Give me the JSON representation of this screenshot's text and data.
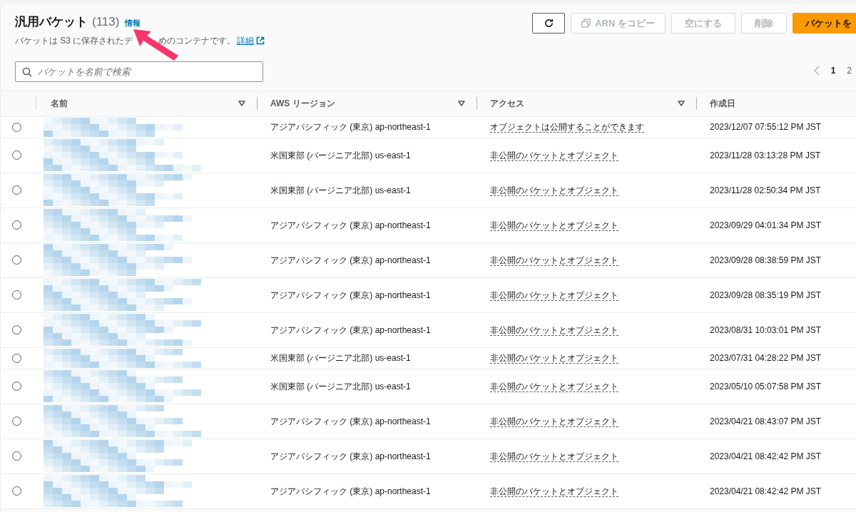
{
  "header": {
    "title": "汎用バケット",
    "count": "(113)",
    "info_link": "情報",
    "description_before": "バケットは S3 に保存されたデ",
    "description_after": "めのコンテナです。",
    "details_link": "詳細"
  },
  "actions": [
    {
      "kind": "refresh",
      "disabled": false
    },
    {
      "kind": "copy",
      "label": "ARN をコピー",
      "disabled": true
    },
    {
      "kind": "plain",
      "label": "空にする",
      "disabled": true
    },
    {
      "kind": "plain",
      "label": "削除",
      "disabled": true
    },
    {
      "kind": "primary",
      "label": "バケットを",
      "disabled": false
    }
  ],
  "search": {
    "placeholder": "バケットを名前で検索"
  },
  "pagination": {
    "pages": [
      {
        "label": "1",
        "selected": true
      },
      {
        "label": "2",
        "selected": false
      }
    ]
  },
  "table": {
    "columns": [
      "名前",
      "AWS リージョン",
      "アクセス",
      "作成日"
    ],
    "rows": [
      {
        "tall": false,
        "selected": false,
        "region": "アジアパシフィック (東京) ap-northeast-1",
        "access": "オブジェクトは公開することができます",
        "created": "2023/12/07 07:55:12 PM JST"
      },
      {
        "tall": true,
        "selected": false,
        "region": "米国東部 (バージニア北部) us-east-1",
        "access": "非公開のバケットとオブジェクト",
        "created": "2023/11/28 03:13:28 PM JST"
      },
      {
        "tall": true,
        "selected": false,
        "region": "米国東部 (バージニア北部) us-east-1",
        "access": "非公開のバケットとオブジェクト",
        "created": "2023/11/28 02:50:34 PM JST"
      },
      {
        "tall": true,
        "selected": false,
        "region": "アジアパシフィック (東京) ap-northeast-1",
        "access": "非公開のバケットとオブジェクト",
        "created": "2023/09/29 04:01:34 PM JST"
      },
      {
        "tall": true,
        "selected": false,
        "region": "アジアパシフィック (東京) ap-northeast-1",
        "access": "非公開のバケットとオブジェクト",
        "created": "2023/09/28 08:38:59 PM JST"
      },
      {
        "tall": true,
        "selected": false,
        "region": "アジアパシフィック (東京) ap-northeast-1",
        "access": "非公開のバケットとオブジェクト",
        "created": "2023/09/28 08:35:19 PM JST"
      },
      {
        "tall": true,
        "selected": false,
        "region": "アジアパシフィック (東京) ap-northeast-1",
        "access": "非公開のバケットとオブジェクト",
        "created": "2023/08/31 10:03:01 PM JST"
      },
      {
        "tall": false,
        "selected": false,
        "region": "米国東部 (バージニア北部) us-east-1",
        "access": "非公開のバケットとオブジェクト",
        "created": "2023/07/31 04:28:22 PM JST"
      },
      {
        "tall": true,
        "selected": false,
        "region": "米国東部 (バージニア北部) us-east-1",
        "access": "非公開のバケットとオブジェクト",
        "created": "2023/05/10 05:07:58 PM JST"
      },
      {
        "tall": true,
        "selected": false,
        "region": "アジアパシフィック (東京) ap-northeast-1",
        "access": "非公開のバケットとオブジェクト",
        "created": "2023/04/21 08:43:07 PM JST"
      },
      {
        "tall": true,
        "selected": false,
        "region": "アジアパシフィック (東京) ap-northeast-1",
        "access": "非公開のバケットとオブジェクト",
        "created": "2023/04/21 08:42:42 PM JST"
      },
      {
        "tall": true,
        "selected": false,
        "region": "アジアパシフィック (東京) ap-northeast-1",
        "access": "非公開のバケットとオブジェクト",
        "created": "2023/04/21 08:42:42 PM JST"
      }
    ]
  }
}
